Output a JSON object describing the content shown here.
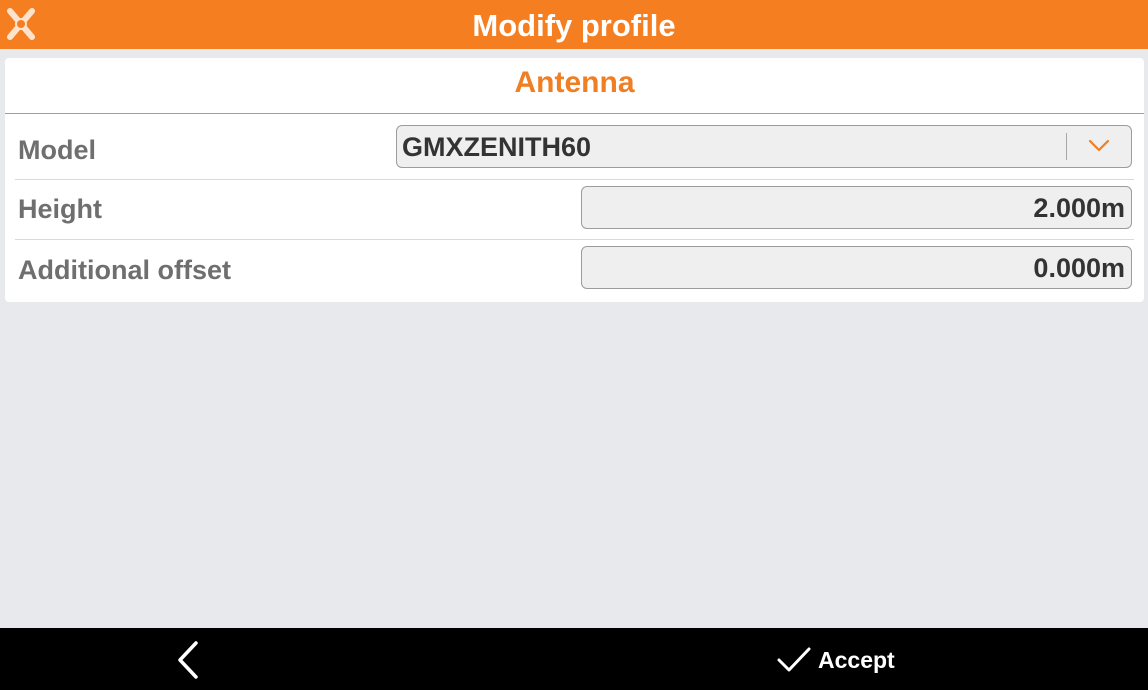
{
  "header": {
    "title": "Modify profile",
    "logo_icon": "app-logo-icon",
    "color": "#f57e20"
  },
  "section": {
    "title": "Antenna",
    "accent_color": "#f07e22"
  },
  "fields": {
    "model": {
      "label": "Model",
      "value": "GMXZENITH60",
      "icon": "chevron-down-icon"
    },
    "height": {
      "label": "Height",
      "value": "2.000m"
    },
    "additional_offset": {
      "label": "Additional offset",
      "value": "0.000m"
    }
  },
  "footer": {
    "back_icon": "chevron-left-icon",
    "accept_icon": "checkmark-icon",
    "accept_label": "Accept"
  }
}
